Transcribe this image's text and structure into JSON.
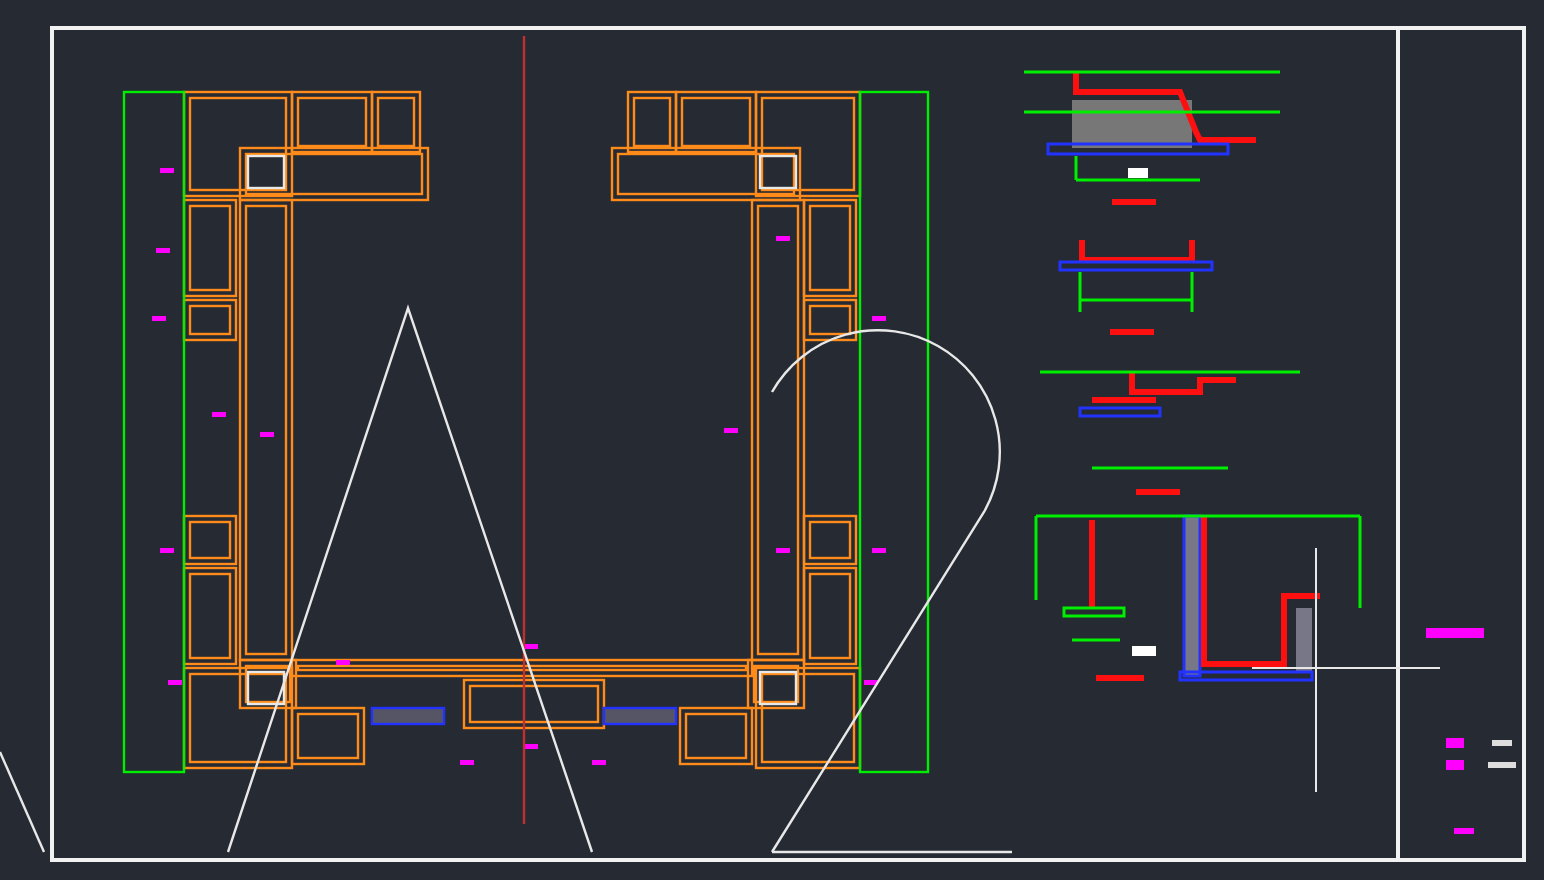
{
  "sheet": {
    "kind": "cad-plan"
  }
}
